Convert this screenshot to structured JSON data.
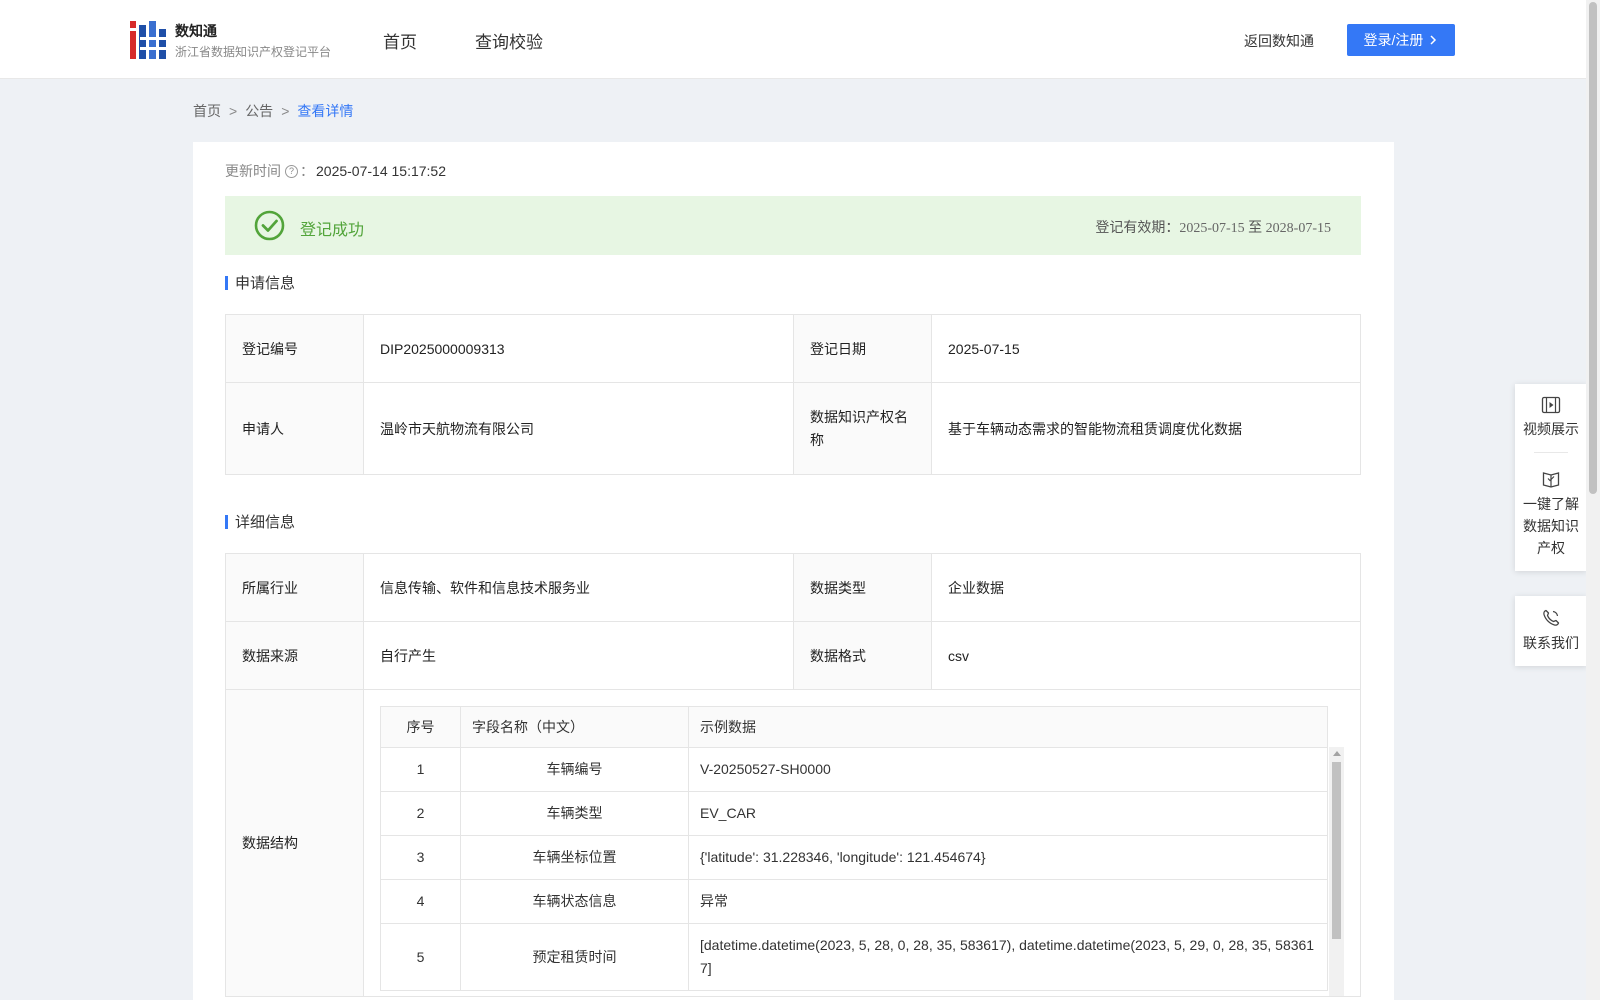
{
  "header": {
    "logo_title": "数知通",
    "logo_subtitle": "浙江省数据知识产权登记平台",
    "nav": [
      "首页",
      "查询校验"
    ],
    "back_link": "返回数知通",
    "login_label": "登录/注册"
  },
  "breadcrumb": {
    "items": [
      "首页",
      "公告"
    ],
    "separator": ">",
    "current": "查看详情"
  },
  "update": {
    "label": "更新时间",
    "suffix": "：",
    "value": "2025-07-14 15:17:52"
  },
  "status": {
    "text": "登记成功",
    "valid_label": "登记有效期：",
    "valid_from": "2025-07-15",
    "valid_to_word": "至",
    "valid_to": "2028-07-15",
    "color": "#52a43a"
  },
  "apply_section": {
    "title": "申请信息",
    "rows": [
      {
        "k1": "登记编号",
        "v1": "DIP2025000009313",
        "k2": "登记日期",
        "v2": "2025-07-15"
      },
      {
        "k1": "申请人",
        "v1": "温岭市天航物流有限公司",
        "k2": "数据知识产权名称",
        "v2": "基于车辆动态需求的智能物流租赁调度优化数据"
      }
    ]
  },
  "detail_section": {
    "title": "详细信息",
    "rows": [
      {
        "k1": "所属行业",
        "v1": "信息传输、软件和信息技术服务业",
        "k2": "数据类型",
        "v2": "企业数据"
      },
      {
        "k1": "数据来源",
        "v1": "自行产生",
        "k2": "数据格式",
        "v2": "csv"
      }
    ],
    "structure_label": "数据结构",
    "structure": {
      "headers": [
        "序号",
        "字段名称（中文）",
        "示例数据"
      ],
      "rows": [
        {
          "no": "1",
          "name": "车辆编号",
          "sample": "V-20250527-SH0000"
        },
        {
          "no": "2",
          "name": "车辆类型",
          "sample": "EV_CAR"
        },
        {
          "no": "3",
          "name": "车辆坐标位置",
          "sample": "{'latitude': 31.228346, 'longitude': 121.454674}"
        },
        {
          "no": "4",
          "name": "车辆状态信息",
          "sample": "异常"
        },
        {
          "no": "5",
          "name": "预定租赁时间",
          "sample": "[datetime.datetime(2023, 5, 28, 0, 28, 35, 583617), datetime.datetime(2023, 5, 29, 0, 28, 35, 583617]"
        }
      ]
    }
  },
  "side_panel": {
    "video": "视频展示",
    "learn": "一键了解数据知识产权",
    "contact": "联系我们"
  },
  "colors": {
    "accent": "#3478f6",
    "success_bg": "#e7f6e3",
    "page_bg": "#eef1f5"
  }
}
